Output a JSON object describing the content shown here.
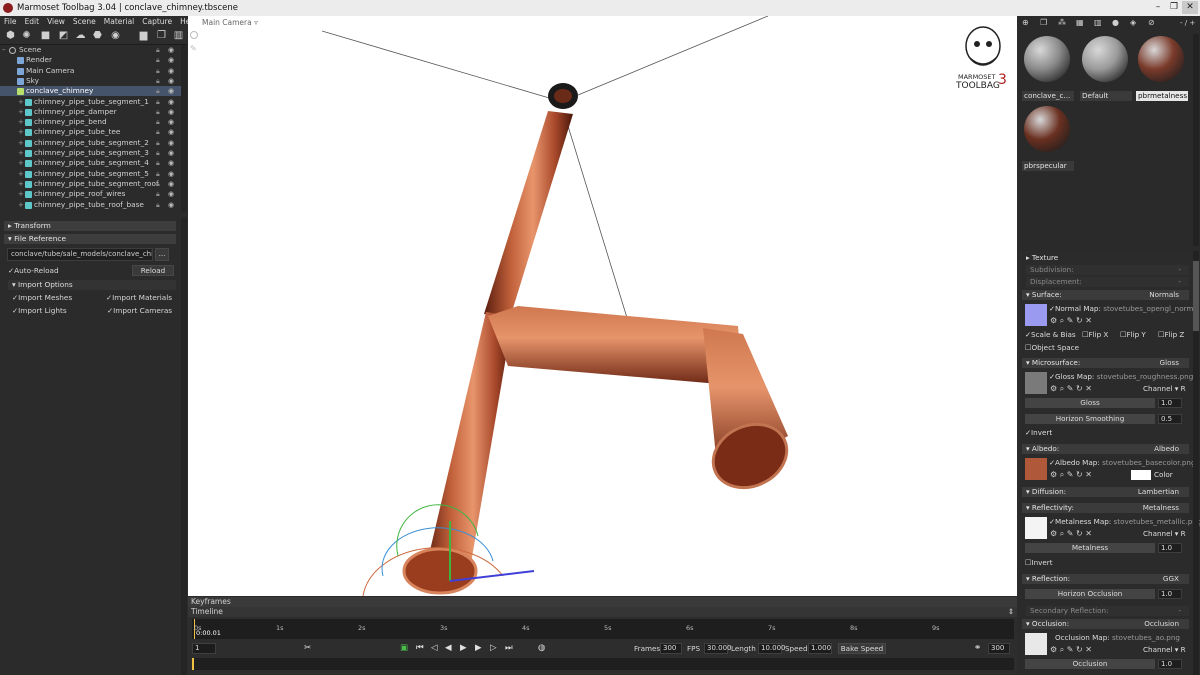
{
  "window": {
    "title": "Marmoset Toolbag 3.04  |  conclave_chimney.tbscene"
  },
  "menu": [
    "File",
    "Edit",
    "View",
    "Scene",
    "Material",
    "Capture",
    "Help"
  ],
  "outliner": {
    "scene": "Scene",
    "items": [
      {
        "label": "Render",
        "depth": 1
      },
      {
        "label": "Main Camera",
        "depth": 1
      },
      {
        "label": "Sky",
        "depth": 1
      },
      {
        "label": "conclave_chimney",
        "depth": 1,
        "selected": true
      },
      {
        "label": "chimney_pipe_tube_segment_1",
        "depth": 2
      },
      {
        "label": "chimney_pipe_damper",
        "depth": 2
      },
      {
        "label": "chimney_pipe_bend",
        "depth": 2
      },
      {
        "label": "chimney_pipe_tube_tee",
        "depth": 2
      },
      {
        "label": "chimney_pipe_tube_segment_2",
        "depth": 2
      },
      {
        "label": "chimney_pipe_tube_segment_3",
        "depth": 2
      },
      {
        "label": "chimney_pipe_tube_segment_4",
        "depth": 2
      },
      {
        "label": "chimney_pipe_tube_segment_5",
        "depth": 2
      },
      {
        "label": "chimney_pipe_tube_segment_roof",
        "depth": 2
      },
      {
        "label": "chimney_pipe_roof_wires",
        "depth": 2
      },
      {
        "label": "chimney_pipe_tube_roof_base",
        "depth": 2
      }
    ]
  },
  "props": {
    "transform": "Transform",
    "file_reference": "File Reference",
    "file_path": "conclave/tube/sale_models/conclave_chim",
    "browse": "...",
    "auto_reload": "Auto-Reload",
    "reload": "Reload",
    "import_options": "Import Options",
    "import_meshes": "Import Meshes",
    "import_materials": "Import Materials",
    "import_lights": "Import Lights",
    "import_cameras": "Import Cameras"
  },
  "viewport": {
    "camera_label": "Main Camera ▿",
    "logo_line1": "MARMOSET",
    "logo_line2": "TOOLBAG",
    "logo_num": "3"
  },
  "materials": {
    "zoom": "- / +",
    "list": [
      {
        "label": "conclave_c...",
        "color": "#8a8a8a"
      },
      {
        "label": "Default",
        "color": "#9a9a9a"
      },
      {
        "label": "pbrmetalness",
        "color": "#7a3a2a",
        "selected": true
      },
      {
        "label": "pbrspecular",
        "color": "#6a3020"
      }
    ]
  },
  "editor": {
    "texture": "Texture",
    "subdivision": {
      "label": "Subdivision:",
      "value": "-"
    },
    "displacement": {
      "label": "Displacement:",
      "value": "-"
    },
    "surface": {
      "label": "Surface:",
      "value": "Normals"
    },
    "normal_map": {
      "label": "Normal Map:",
      "file": "stovetubes_opengl_norma"
    },
    "scale_bias": "Scale & Bias",
    "flip_x": "Flip X",
    "flip_y": "Flip Y",
    "flip_z": "Flip Z",
    "object_space": "Object Space",
    "microsurface": {
      "label": "Microsurface:",
      "value": "Gloss"
    },
    "gloss_map": {
      "label": "Gloss Map:",
      "file": "stovetubes_roughness.png"
    },
    "channel_r": "Channel ▾ R",
    "gloss": {
      "label": "Gloss",
      "value": "1.0"
    },
    "horizon_smoothing": {
      "label": "Horizon Smoothing",
      "value": "0.5"
    },
    "invert": "Invert",
    "albedo": {
      "label": "Albedo:",
      "value": "Albedo"
    },
    "albedo_map": {
      "label": "Albedo Map:",
      "file": "stovetubes_basecolor.png"
    },
    "color": "Color",
    "diffusion": {
      "label": "Diffusion:",
      "value": "Lambertian"
    },
    "reflectivity": {
      "label": "Reflectivity:",
      "value": "Metalness"
    },
    "metalness_map": {
      "label": "Metalness Map:",
      "file": "stovetubes_metallic.png"
    },
    "metalness": {
      "label": "Metalness",
      "value": "1.0"
    },
    "reflection": {
      "label": "Reflection:",
      "value": "GGX"
    },
    "horizon_occlusion": {
      "label": "Horizon Occlusion",
      "value": "1.0"
    },
    "secondary_reflection": {
      "label": "Secondary Reflection:",
      "value": "-"
    },
    "occlusion": {
      "label": "Occlusion:",
      "value": "Occlusion"
    },
    "occlusion_map": {
      "label": "Occlusion Map:",
      "file": "stovetubes_ao.png"
    },
    "occlusion_value": {
      "label": "Occlusion",
      "value": "1.0"
    }
  },
  "timeline": {
    "keyframes": "Keyframes",
    "timeline": "Timeline",
    "current_time": "0:00.01",
    "ticks": [
      "0s",
      "1s",
      "2s",
      "3s",
      "4s",
      "5s",
      "6s",
      "7s",
      "8s",
      "9s"
    ],
    "frame": "1",
    "frames_label": "Frames",
    "frames": "300",
    "fps_label": "FPS",
    "fps": "30.000",
    "length_label": "Length",
    "length": "10.000",
    "speed_label": "Speed",
    "speed": "1.000",
    "bake_speed": "Bake Speed",
    "end_frame": "300"
  }
}
